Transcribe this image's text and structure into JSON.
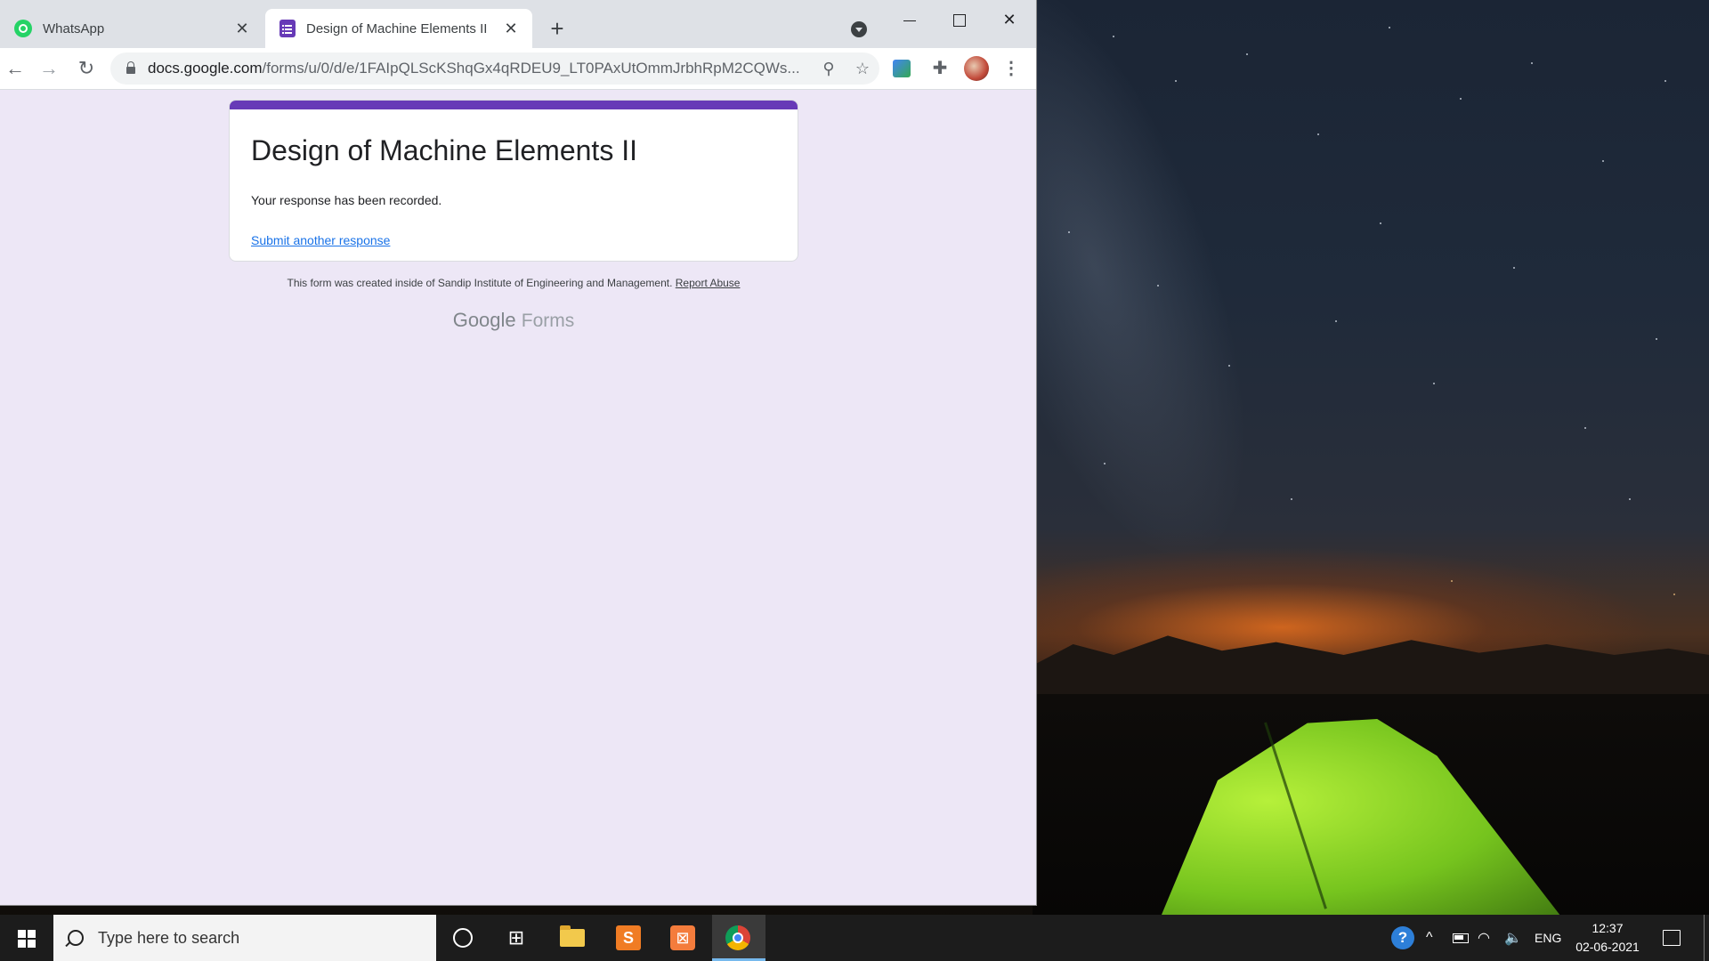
{
  "browser": {
    "tabs": [
      {
        "label": "WhatsApp",
        "icon": "whatsapp-icon",
        "active": false
      },
      {
        "label": "Design of Machine Elements II",
        "icon": "google-forms-icon",
        "active": true
      }
    ],
    "new_tab_label": "+",
    "url_host": "docs.google.com",
    "url_path": "/forms/u/0/d/e/1FAIpQLScKShqGx4qRDEU9_LT0PAxUtOmmJrbhRpM2CQWs..."
  },
  "form": {
    "title": "Design of Machine Elements II",
    "message": "Your response has been recorded.",
    "submit_another": "Submit another response",
    "footer_text": "This form was created inside of Sandip Institute of Engineering and Management.",
    "report_abuse": "Report Abuse",
    "brand_google": "Google",
    "brand_forms": "Forms",
    "accent_color": "#673ab7",
    "page_background": "#ede7f6"
  },
  "taskbar": {
    "search_placeholder": "Type here to search",
    "apps": [
      "cortana-icon",
      "task-view-icon",
      "file-explorer-icon",
      "sublime-text-icon",
      "xampp-icon",
      "chrome-icon"
    ],
    "language": "ENG",
    "time": "12:37",
    "date": "02-06-2021"
  }
}
